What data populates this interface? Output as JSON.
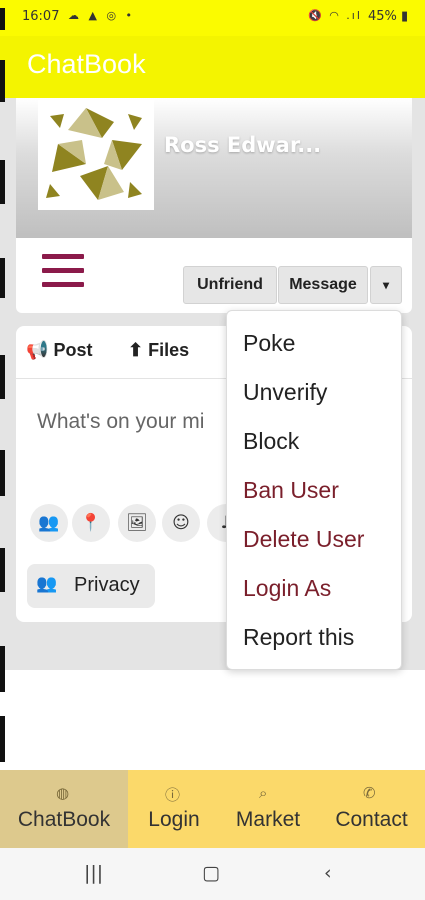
{
  "status_bar": {
    "time": "16:07",
    "left_icons": "☁ ▲ ◎ •",
    "right_icons": "🔇 ◠ .ıl",
    "battery": "45%"
  },
  "app": {
    "title": "ChatBook"
  },
  "profile": {
    "name": "Ross Edwar..."
  },
  "actions": {
    "unfriend": "Unfriend",
    "message": "Message",
    "more_icon": "▾"
  },
  "composer": {
    "tabs": [
      {
        "label": "Post",
        "icon": "megaphone-icon"
      },
      {
        "label": "Files",
        "icon": "upload-icon"
      }
    ],
    "placeholder": "What's on your mi",
    "tools": [
      "group-icon",
      "location-icon",
      "image-icon",
      "smiley-icon",
      "music-icon"
    ],
    "privacy_label": "Privacy"
  },
  "dropdown": {
    "items": [
      {
        "label": "Poke",
        "color": "#222222"
      },
      {
        "label": "Unverify",
        "color": "#222222"
      },
      {
        "label": "Block",
        "color": "#222222"
      },
      {
        "label": "Ban User",
        "color": "#7a1f2b"
      },
      {
        "label": "Delete User",
        "color": "#7a1f2b"
      },
      {
        "label": "Login As",
        "color": "#7a1f2b"
      },
      {
        "label": "Report this",
        "color": "#222222"
      }
    ]
  },
  "bottom_nav": {
    "items": [
      {
        "label": "ChatBook",
        "icon": "globe-icon",
        "active": true
      },
      {
        "label": "Login",
        "icon": "user-circle-icon",
        "active": false
      },
      {
        "label": "Market",
        "icon": "search-icon",
        "active": false
      },
      {
        "label": "Contact",
        "icon": "phone-icon",
        "active": false
      }
    ]
  },
  "colors": {
    "app_bar": "#f4f400",
    "accent": "#8b1a4a",
    "bottom_nav": "#fbd96a",
    "danger": "#7a1f2b"
  }
}
